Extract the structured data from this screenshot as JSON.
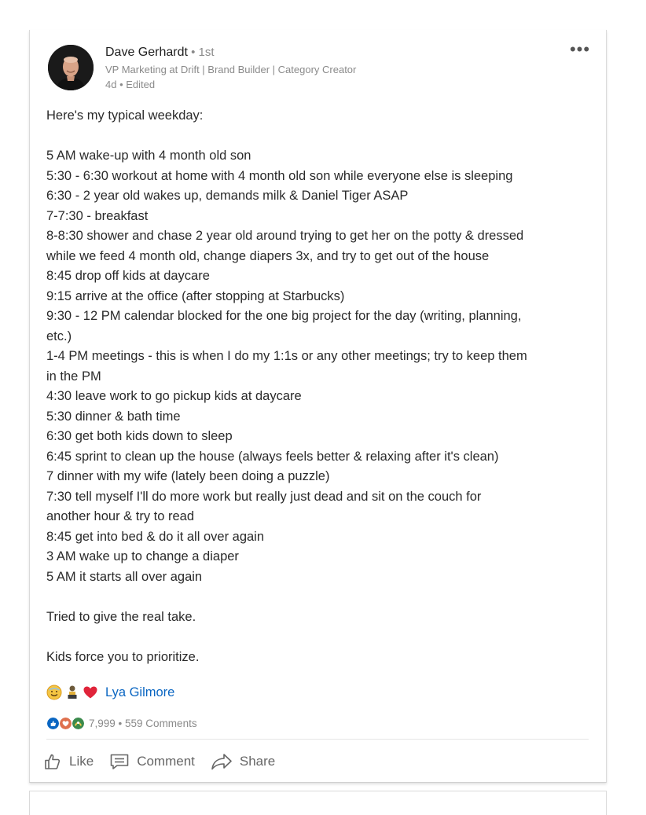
{
  "post": {
    "author": {
      "name": "Dave Gerhardt",
      "degree": " • 1st",
      "headline": "VP Marketing at Drift | Brand Builder | Category Creator",
      "meta": "4d • Edited"
    },
    "more_label": "•••",
    "body_lines": [
      "Here's my typical weekday:",
      "",
      "5 AM wake-up with 4 month old son",
      "5:30 - 6:30 workout at home with 4 month old son while everyone else is sleeping",
      "6:30 - 2 year old wakes up, demands milk & Daniel Tiger ASAP",
      "7-7:30 - breakfast",
      "8-8:30 shower and chase 2 year old around trying to get her on the potty & dressed",
      "while we feed 4 month old, change diapers 3x, and try to get out of the house",
      "8:45 drop off kids at daycare",
      "9:15 arrive at the office (after stopping at Starbucks)",
      "9:30 - 12 PM calendar blocked for the one big project for the day (writing, planning,",
      "etc.)",
      "1-4 PM meetings - this is when I do my 1:1s or any other meetings; try to keep them",
      "in the PM",
      "4:30 leave work to go pickup kids at daycare",
      "5:30 dinner & bath time",
      "6:30 get both kids down to sleep",
      "6:45 sprint to clean up the house (always feels better & relaxing after it's clean)",
      "7 dinner with my wife (lately been doing a puzzle)",
      "7:30 tell myself I'll do more work but really just dead and sit on the couch for",
      "another hour & try to read",
      "8:45 get into bed & do it all over again",
      "3 AM wake up to change a diaper",
      "5 AM it starts all over again",
      "",
      "Tried to give the real take.",
      "",
      "Kids force you to prioritize."
    ],
    "reactor": {
      "name": "Lya Gilmore",
      "emojis": [
        "smiling-face-emoji",
        "person-emoji",
        "red-heart-emoji"
      ]
    },
    "stats": {
      "reaction_icons": [
        {
          "name": "like-reaction-icon",
          "color": "#0a66c2"
        },
        {
          "name": "love-reaction-icon",
          "color": "#df704d"
        },
        {
          "name": "insightful-reaction-icon",
          "color": "#3b8a4c"
        }
      ],
      "reactions_count": "7,999",
      "separator": " • ",
      "comments_count": "559 Comments"
    },
    "actions": {
      "like_label": "Like",
      "comment_label": "Comment",
      "share_label": "Share"
    }
  }
}
